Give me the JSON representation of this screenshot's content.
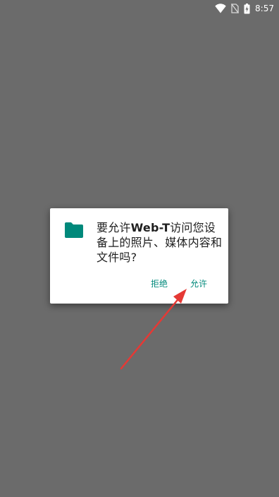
{
  "status_bar": {
    "time": "8:57",
    "icons": [
      "wifi-icon",
      "no-sim-icon",
      "battery-charging-icon"
    ]
  },
  "dialog": {
    "icon": "folder-icon",
    "message_prefix": "要允许",
    "app_name": "Web-T",
    "message_suffix": "访问您设备上的照片、媒体内容和文件吗?",
    "deny_label": "拒绝",
    "allow_label": "允许",
    "accent_color": "#00897b"
  },
  "annotation": {
    "arrow_color": "#e53935"
  }
}
